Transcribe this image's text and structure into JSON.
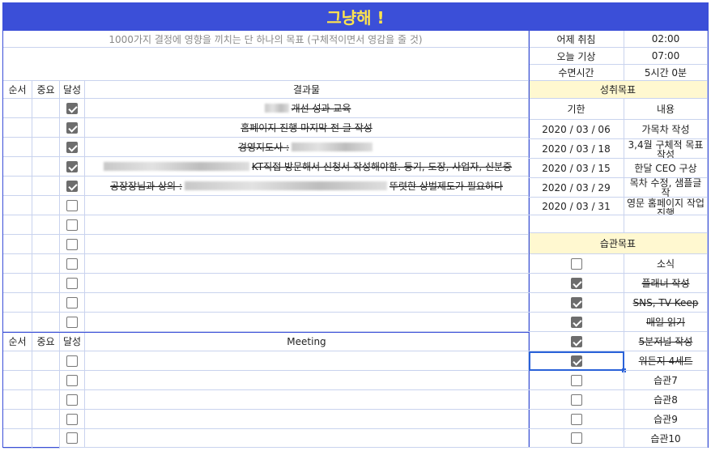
{
  "title": "그냥해 !",
  "goal_prompt": "1000가지 결정에 영향을 끼치는 단 하나의 목표 (구체적이면서 영감을 줄 것)",
  "sleep": [
    {
      "label": "어제 취침",
      "value": "02:00"
    },
    {
      "label": "오늘 기상",
      "value": "07:00"
    },
    {
      "label": "수면시간",
      "value": "5시간 0분"
    }
  ],
  "results_header": {
    "order": "순서",
    "importance": "중요",
    "done": "달성",
    "title": "결과물"
  },
  "results": [
    {
      "checked": true,
      "text_before": "",
      "text_after": "개선 성과 교육"
    },
    {
      "checked": true,
      "text_before": "홈페이지 진행 마지막 전 글 작성",
      "text_after": ""
    },
    {
      "checked": true,
      "text_before": "경영지도사 :",
      "text_after": ""
    },
    {
      "checked": true,
      "text_before": "",
      "text_after": "KT직접 방문해서 신청서 작성해야함. 등기, 도장, 사업자, 신분증"
    },
    {
      "checked": true,
      "text_before": "공장장님과 상의 :",
      "text_after": "뚜렷한 상벌제도가 필요하다"
    },
    {
      "checked": false,
      "text_before": "",
      "text_after": ""
    },
    {
      "checked": false,
      "text_before": "",
      "text_after": ""
    },
    {
      "checked": false,
      "text_before": "",
      "text_after": ""
    },
    {
      "checked": false,
      "text_before": "",
      "text_after": ""
    },
    {
      "checked": false,
      "text_before": "",
      "text_after": ""
    },
    {
      "checked": false,
      "text_before": "",
      "text_after": ""
    },
    {
      "checked": false,
      "text_before": "",
      "text_after": ""
    }
  ],
  "meeting_header": {
    "order": "순서",
    "importance": "중요",
    "done": "달성",
    "title": "Meeting"
  },
  "meetings": [
    {
      "checked": false
    },
    {
      "checked": false
    },
    {
      "checked": false
    },
    {
      "checked": false
    },
    {
      "checked": false
    }
  ],
  "achievement": {
    "title": "성취목표",
    "col_deadline": "기한",
    "col_content": "내용",
    "items": [
      {
        "deadline": "2020 / 03 / 06",
        "content": "가목차 작성"
      },
      {
        "deadline": "2020 / 03 / 18",
        "content": "3,4월 구체적 목표 작성"
      },
      {
        "deadline": "2020 / 03 / 15",
        "content": "한달 CEO 구상"
      },
      {
        "deadline": "2020 / 03 / 29",
        "content": "목차 수정, 샘플글 작"
      },
      {
        "deadline": "2020 / 03 / 31",
        "content": "영문 홈페이지 작업 진행"
      }
    ]
  },
  "habits": {
    "title": "습관목표",
    "items": [
      {
        "checked": false,
        "label": "소식",
        "strike": false
      },
      {
        "checked": true,
        "label": "플래너 작성",
        "strike": true
      },
      {
        "checked": true,
        "label": "SNS, TV Keep",
        "strike": true
      },
      {
        "checked": true,
        "label": "매일 읽기",
        "strike": true
      },
      {
        "checked": true,
        "label": "5분저널 작성",
        "strike": true
      },
      {
        "checked": true,
        "label": "워든지 4세트",
        "strike": true
      },
      {
        "checked": false,
        "label": "습관7",
        "strike": false
      },
      {
        "checked": false,
        "label": "습관8",
        "strike": false
      },
      {
        "checked": false,
        "label": "습관9",
        "strike": false
      },
      {
        "checked": false,
        "label": "습관10",
        "strike": false
      }
    ]
  },
  "colors": {
    "title_bg": "#3b4fd8",
    "title_fg": "#ffe44d",
    "header_yellow": "#fff8d0",
    "grid_line": "#c9d3ee"
  }
}
